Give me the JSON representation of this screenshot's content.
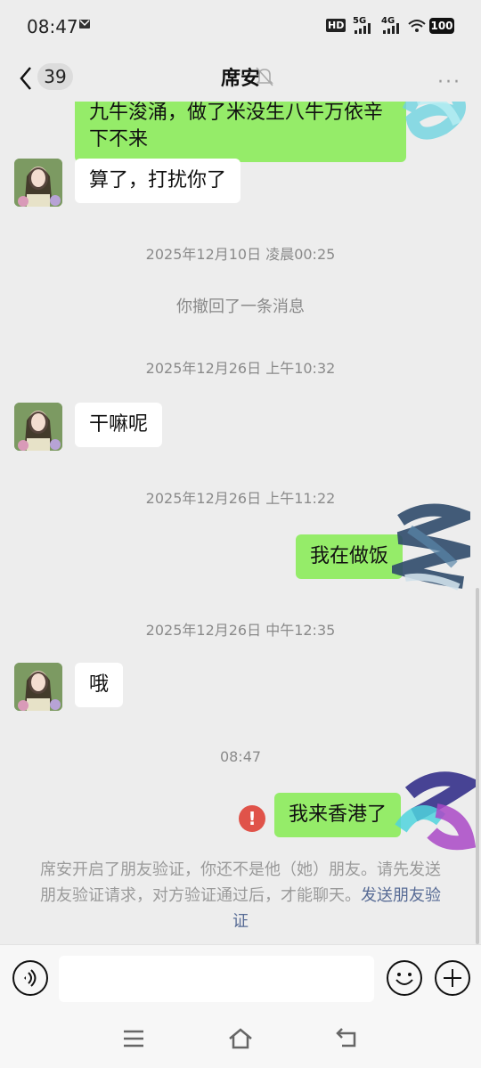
{
  "status_bar": {
    "time": "08:47",
    "battery": "100",
    "net1": "5G",
    "net2": "4G",
    "hd": "HD"
  },
  "header": {
    "unread_count": "39",
    "title": "席安",
    "more": "···"
  },
  "messages": {
    "m1": {
      "line1": "九牛浚涌，做了米没生八牛万依辛",
      "line2": "下不来"
    },
    "m2": "算了，打扰你了",
    "t1": "2025年12月10日 凌晨00:25",
    "recall": "你撤回了一条消息",
    "t2": "2025年12月26日 上午10:32",
    "m3": "干嘛呢",
    "t3": "2025年12月26日 上午11:22",
    "m4": "我在做饭",
    "t4": "2025年12月26日 中午12:35",
    "m5": "哦",
    "t5": "08:47",
    "m6": "我来香港了",
    "error_mark": "!"
  },
  "notice": {
    "text": "席安开启了朋友验证，你还不是他（她）朋友。请先发送朋友验证请求，对方验证通过后，才能聊天。",
    "link": "发送朋友验证"
  },
  "colors": {
    "sent_bubble": "#95ec69",
    "received_bubble": "#ffffff",
    "error": "#e0534a",
    "link": "#576b95"
  },
  "icons": [
    "back-arrow-icon",
    "mute-bell-icon",
    "voice-icon",
    "emoji-icon",
    "plus-icon",
    "menu-icon",
    "home-icon",
    "back-nav-icon"
  ]
}
